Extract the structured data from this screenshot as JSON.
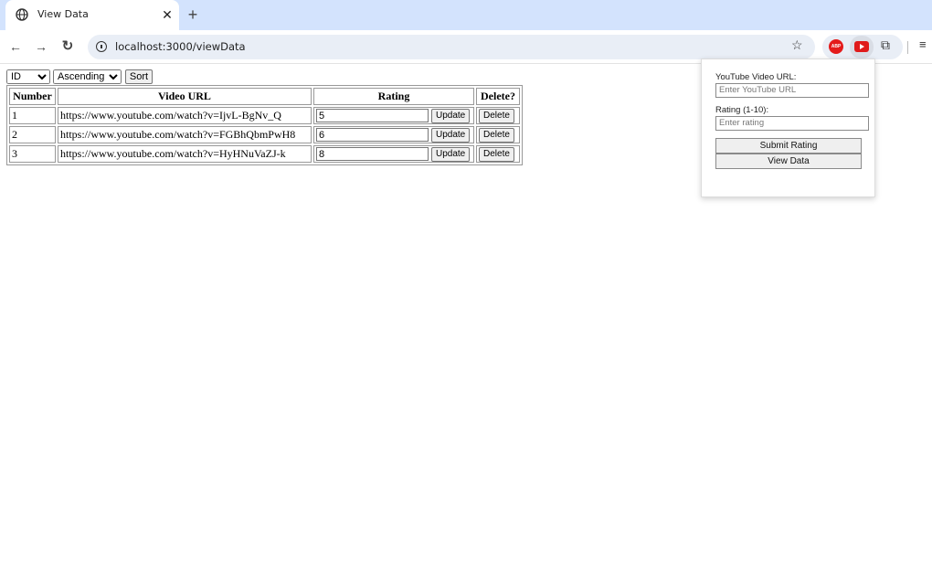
{
  "tab": {
    "title": "View Data",
    "close": "✕",
    "new_tab": "+"
  },
  "toolbar": {
    "back": "←",
    "forward": "→",
    "reload": "↻",
    "url": "localhost:3000/viewData",
    "bookmark": "☆",
    "extensions": {
      "abp_label": "ABP",
      "puzzle": "⧉"
    },
    "menu": "≡"
  },
  "controls": {
    "sort_field": "ID",
    "sort_order": "Ascending",
    "sort_button": "Sort"
  },
  "table": {
    "headers": [
      "Number",
      "Video URL",
      "Rating",
      "Delete?"
    ],
    "rows": [
      {
        "number": "1",
        "url": "https://www.youtube.com/watch?v=IjvL-BgNv_Q",
        "rating": "5",
        "update": "Update",
        "delete": "Delete"
      },
      {
        "number": "2",
        "url": "https://www.youtube.com/watch?v=FGBhQbmPwH8",
        "rating": "6",
        "update": "Update",
        "delete": "Delete"
      },
      {
        "number": "3",
        "url": "https://www.youtube.com/watch?v=HyHNuVaZJ-k",
        "rating": "8",
        "update": "Update",
        "delete": "Delete"
      }
    ]
  },
  "popup": {
    "url_label": "YouTube Video URL:",
    "url_placeholder": "Enter YouTube URL",
    "rating_label": "Rating (1-10):",
    "rating_placeholder": "Enter rating",
    "submit": "Submit Rating",
    "view": "View Data"
  },
  "colors": {
    "tabstrip": "#d3e3fd",
    "omnibox": "#e9eef6",
    "youtube_red": "#e01a1a"
  }
}
